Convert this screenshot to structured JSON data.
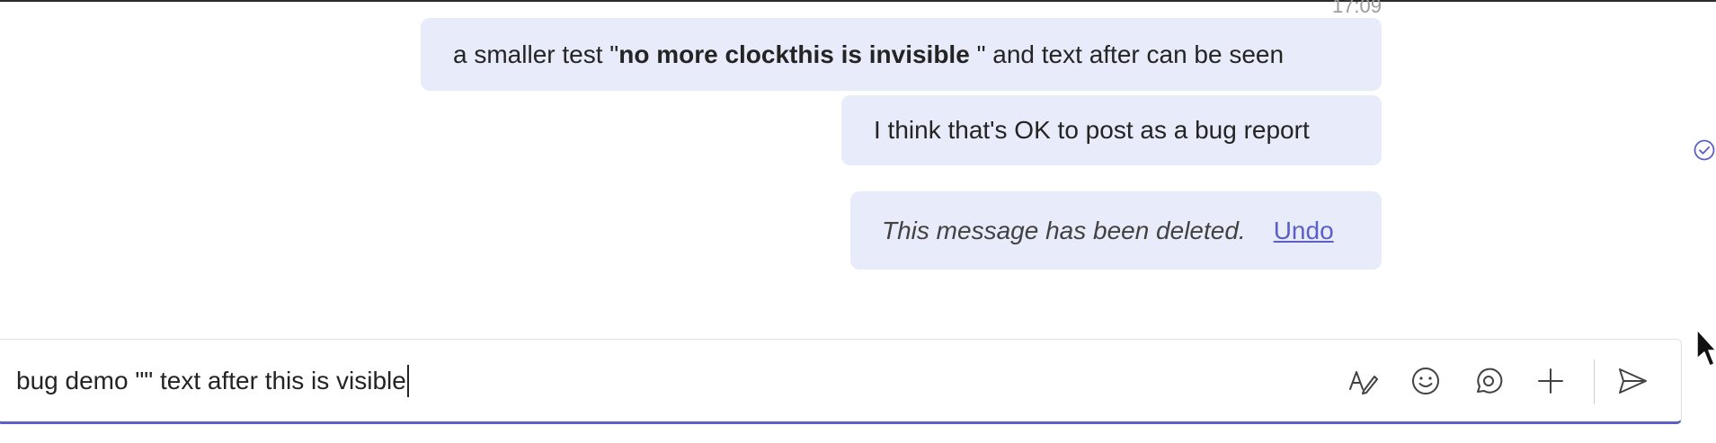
{
  "chat": {
    "timestamp": "17:09",
    "messages": [
      {
        "segments": [
          {
            "text": "a smaller test \"",
            "bold": false
          },
          {
            "text": "no more clockthis is invisible ",
            "bold": true
          },
          {
            "text": "\"  and text after can be seen",
            "bold": false
          }
        ]
      },
      {
        "text": "I think that's OK to post as a bug report"
      },
      {
        "deleted_text": "This message has been deleted.",
        "undo_label": "Undo"
      }
    ],
    "read_receipt_icon": "check-circle-icon"
  },
  "composer": {
    "value": "bug demo \"\" text after this is visible",
    "tools": [
      {
        "icon": "format-icon"
      },
      {
        "icon": "emoji-icon"
      },
      {
        "icon": "loop-icon"
      },
      {
        "icon": "plus-icon"
      },
      {
        "icon": "send-icon"
      }
    ]
  },
  "colors": {
    "bubble_bg": "#e8ebfa",
    "accent": "#5b5fc7",
    "text": "#242424"
  }
}
